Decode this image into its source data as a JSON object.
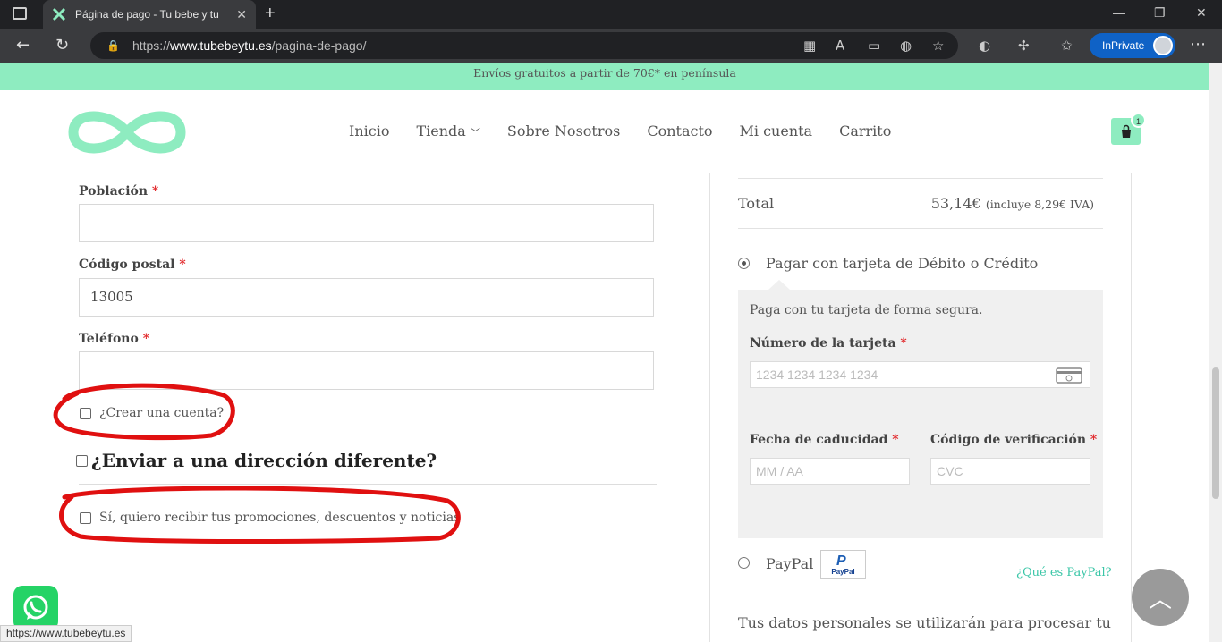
{
  "browser": {
    "tab_title": "Página de pago - Tu bebe y tu",
    "tab_close": "✕",
    "new_tab": "+",
    "url_prefix": "https://",
    "url_host": "www.tubebeytu.es",
    "url_path": "/pagina-de-pago/",
    "inprivate_label": "InPrivate",
    "status_url": "https://www.tubebeytu.es"
  },
  "promo": {
    "text": "Envíos gratuitos a partir de 70€* en península"
  },
  "nav": {
    "items": [
      {
        "label": "Inicio"
      },
      {
        "label": "Tienda"
      },
      {
        "label": "Sobre Nosotros"
      },
      {
        "label": "Contacto"
      },
      {
        "label": "Mi cuenta"
      },
      {
        "label": "Carrito"
      }
    ],
    "cart_count": "1"
  },
  "form": {
    "city_label": "Población",
    "city_value": "",
    "postcode_label": "Código postal",
    "postcode_value": "13005",
    "phone_label": "Teléfono",
    "phone_value": "",
    "required_mark": "*",
    "create_account_label": "¿Crear una cuenta?",
    "ship_different_label": "¿Enviar a una dirección diferente?",
    "newsletter_label": "Sí, quiero recibir tus promociones, descuentos y noticias"
  },
  "order": {
    "total_label": "Total",
    "total_value": "53,14€",
    "total_tax": "(incluye 8,29€ IVA)"
  },
  "payment": {
    "card_option_label": "Pagar con tarjeta de Débito o Crédito",
    "card_intro": "Paga con tu tarjeta de forma segura.",
    "card_number_label": "Número de la tarjeta",
    "card_number_placeholder": "1234 1234 1234 1234",
    "expiry_label": "Fecha de caducidad",
    "expiry_placeholder": "MM / AA",
    "cvc_label": "Código de verificación",
    "cvc_placeholder": "CVC",
    "paypal_label": "PayPal",
    "paypal_logo_text": "PayPal",
    "paypal_link": "¿Qué es PayPal?",
    "privacy_text": "Tus datos personales se utilizarán para procesar tu"
  },
  "colors": {
    "brand": "#8eecc0",
    "accent_link": "#3ac6a7",
    "required": "#e2282b",
    "annotation": "#e01010"
  }
}
